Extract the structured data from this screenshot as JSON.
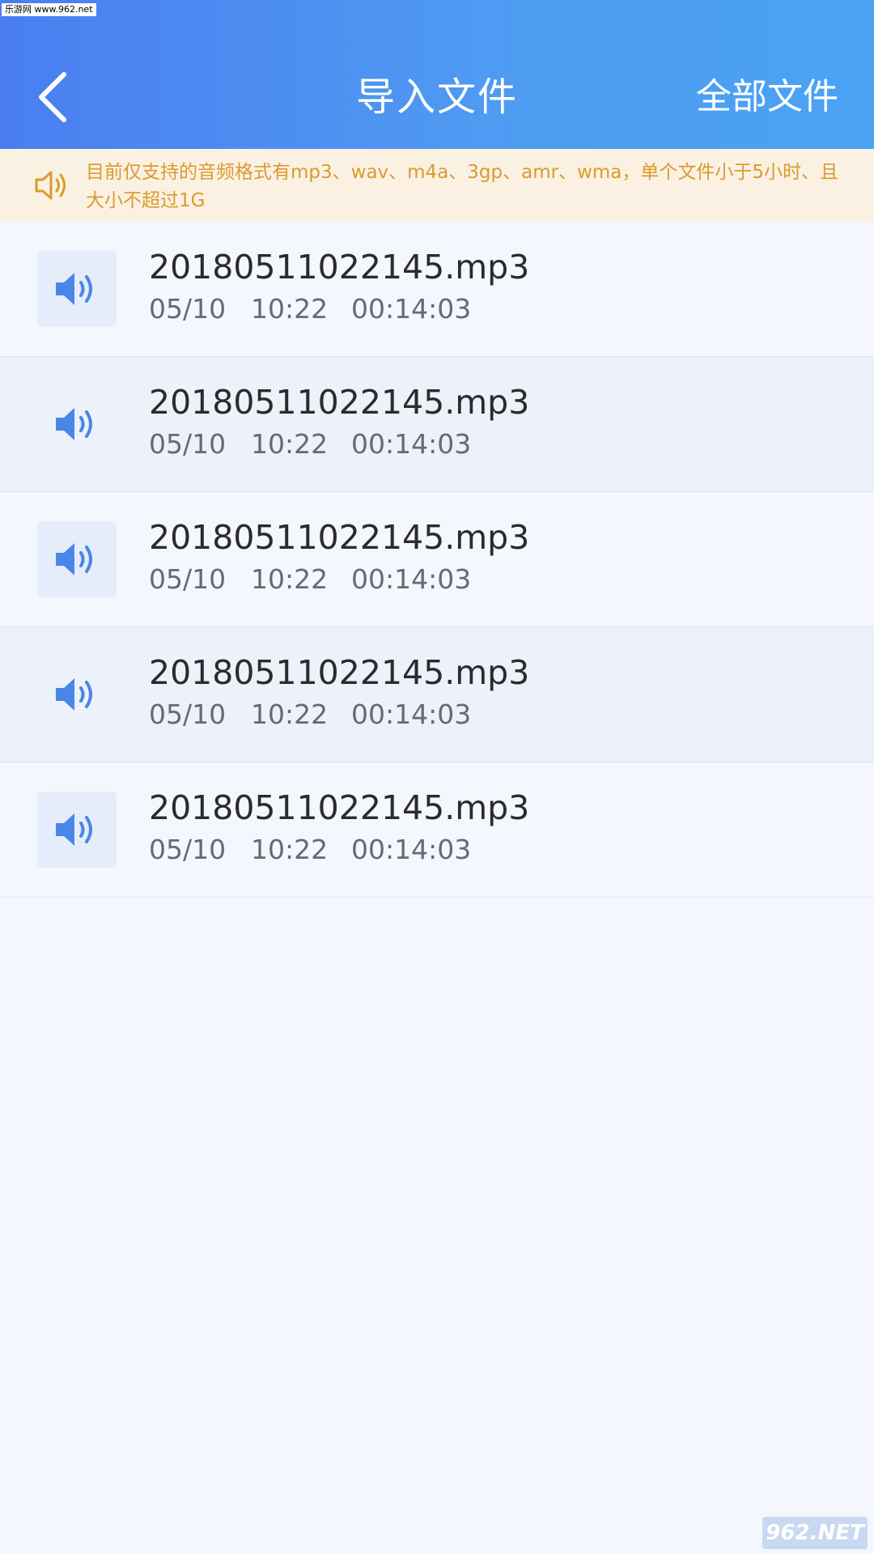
{
  "watermark_top": "乐游网 www.962.net",
  "header": {
    "title": "导入文件",
    "all_files_label": "全部文件"
  },
  "notice": {
    "text": "目前仅支持的音频格式有mp3、wav、m4a、3gp、amr、wma，单个文件小于5小时、且大小不超过1G"
  },
  "files": [
    {
      "name": "20180511022145.mp3",
      "date": "05/10",
      "time": "10:22",
      "duration": "00:14:03"
    },
    {
      "name": "20180511022145.mp3",
      "date": "05/10",
      "time": "10:22",
      "duration": "00:14:03"
    },
    {
      "name": "20180511022145.mp3",
      "date": "05/10",
      "time": "10:22",
      "duration": "00:14:03"
    },
    {
      "name": "20180511022145.mp3",
      "date": "05/10",
      "time": "10:22",
      "duration": "00:14:03"
    },
    {
      "name": "20180511022145.mp3",
      "date": "05/10",
      "time": "10:22",
      "duration": "00:14:03"
    }
  ],
  "watermark_bottom": "962.NET",
  "colors": {
    "header_start": "#4a7ef0",
    "header_end": "#4aa3f4",
    "notice_bg": "#fbf1e3",
    "notice_text": "#d99b2c",
    "icon_blue": "#4a86e8"
  },
  "icons": {
    "back": "chevron-left-icon",
    "notice": "speaker-outline-icon",
    "file": "speaker-filled-icon"
  }
}
